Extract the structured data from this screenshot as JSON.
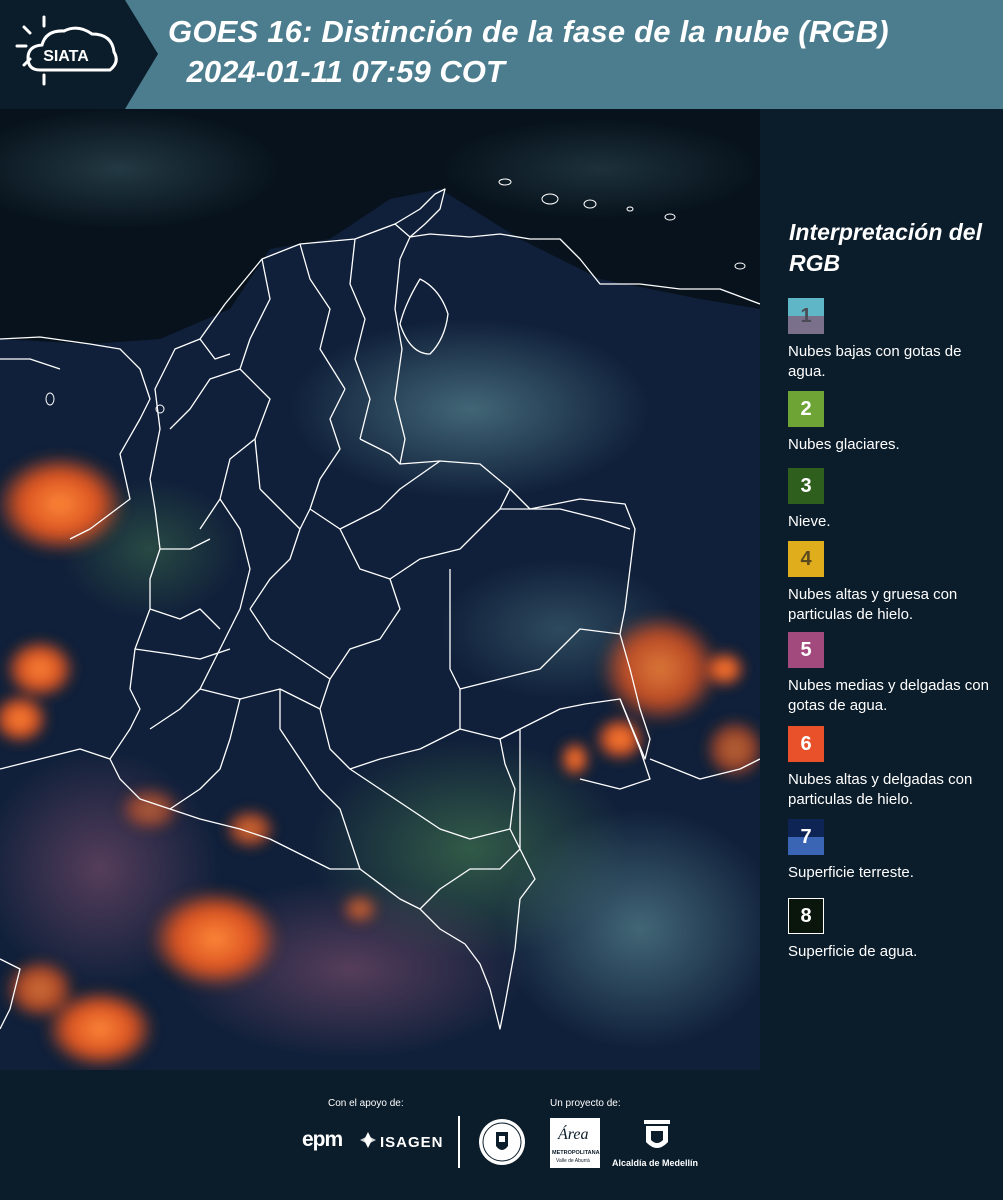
{
  "header": {
    "logo_text": "SIATA",
    "title_line_1": "GOES 16: Distinción de la fase de la nube (RGB)",
    "title_line_2": " 2024-01-11 07:59 COT"
  },
  "map": {
    "content": "GOES-16 Cloud Phase Distinction RGB satellite image over Colombia with department boundaries",
    "colors": {
      "background_land": "#0f1f33",
      "ocean": "#07121c",
      "borders": "#ffffff",
      "ice_cloud": "#ff6a2a",
      "low_cloud": "#6f8fa0"
    }
  },
  "legend": {
    "title": "Interpretación del RGB",
    "items": [
      {
        "number": "1",
        "label": "Nubes bajas con gotas de agua.",
        "color_top": "#5fb6c6",
        "color_bottom": "#7a708c",
        "num_color": "#4b4b55"
      },
      {
        "number": "2",
        "label": "Nubes glaciares.",
        "color_top": "#6ea436",
        "color_bottom": "#6ea436",
        "num_color": "#ffffff"
      },
      {
        "number": "3",
        "label": "Nieve.",
        "color_top": "#2e5f1c",
        "color_bottom": "#2e5f1c",
        "num_color": "#ffffff"
      },
      {
        "number": "4",
        "label": "Nubes altas y gruesa con particulas de hielo.",
        "color_top": "#e0ae1c",
        "color_bottom": "#e0ae1c",
        "num_color": "#5a4a20"
      },
      {
        "number": "5",
        "label": "Nubes medias y delgadas con gotas de agua.",
        "color_top": "#a24a7e",
        "color_bottom": "#a24a7e",
        "num_color": "#ffffff"
      },
      {
        "number": "6",
        "label": "Nubes altas y delgadas con particulas de hielo.",
        "color_top": "#e8512a",
        "color_bottom": "#e8512a",
        "num_color": "#ffffff"
      },
      {
        "number": "7",
        "label": "Superficie terreste.",
        "color_top": "#0d2455",
        "color_bottom": "#3a64b4",
        "num_color": "#ffffff"
      },
      {
        "number": "8",
        "label": "Superficie de agua.",
        "color_top": "#0a150c",
        "color_bottom": "#0a150c",
        "num_color": "#ffffff"
      }
    ]
  },
  "footer": {
    "support_label": "Con el apoyo de:",
    "project_label": "Un proyecto de:",
    "epm": "epm",
    "isagen": "ISAGEN",
    "area_metro": "Área",
    "area_metro_sub": "METROPOLITANA",
    "area_metro_sub2": "Valle de Aburrá",
    "alcaldia": "Alcaldía de Medellín"
  }
}
